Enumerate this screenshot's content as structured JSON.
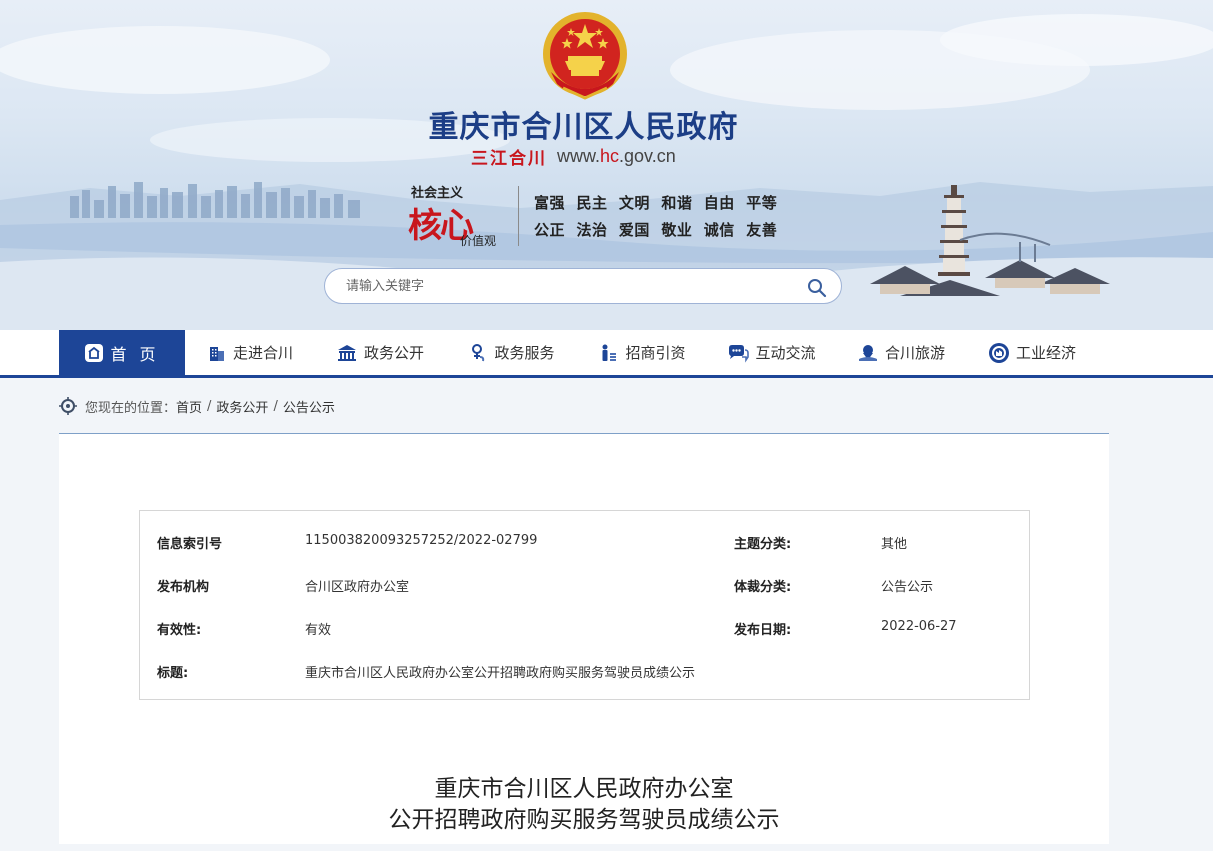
{
  "header": {
    "site_title": "重庆市合川区人民政府",
    "slogan": "三江合川",
    "url_prefix": "www.",
    "url_highlight": "hc",
    "url_suffix": ".gov.cn",
    "core_values": {
      "small": "社会主义",
      "big": "核心",
      "sub": "价值观",
      "line1": "富强  民主  文明  和谐  自由  平等",
      "line2": "公正  法治  爱国  敬业  诚信  友善"
    }
  },
  "search": {
    "placeholder": "请输入关键字"
  },
  "nav": {
    "items": [
      {
        "label": "首 页",
        "icon": "home-icon",
        "active": true
      },
      {
        "label": "走进合川",
        "icon": "building-icon"
      },
      {
        "label": "政务公开",
        "icon": "government-hall-icon"
      },
      {
        "label": "政务服务",
        "icon": "service-person-icon"
      },
      {
        "label": "招商引资",
        "icon": "investment-icon"
      },
      {
        "label": "互动交流",
        "icon": "chat-icon"
      },
      {
        "label": "合川旅游",
        "icon": "travel-icon"
      },
      {
        "label": "工业经济",
        "icon": "industry-icon"
      }
    ]
  },
  "breadcrumb": {
    "prefix": "您现在的位置：",
    "items": [
      "首页",
      "政务公开",
      "公告公示"
    ]
  },
  "info": {
    "index_no_label": "信息索引号",
    "index_no": "115003820093257252/2022-02799",
    "topic_label": "主题分类:",
    "topic": "其他",
    "publisher_label": "发布机构",
    "publisher": "合川区政府办公室",
    "genre_label": "体裁分类:",
    "genre": "公告公示",
    "validity_label": "有效性:",
    "validity": "有效",
    "date_label": "发布日期:",
    "date": "2022-06-27",
    "title_label": "标题:",
    "title": "重庆市合川区人民政府办公室公开招聘政府购买服务驾驶员成绩公示"
  },
  "document": {
    "title_line1": "重庆市合川区人民政府办公室",
    "title_line2": "公开招聘政府购买服务驾驶员成绩公示"
  },
  "colors": {
    "brand_blue": "#1d4597",
    "title_blue": "#1c3e86",
    "accent_red": "#c8161d"
  }
}
